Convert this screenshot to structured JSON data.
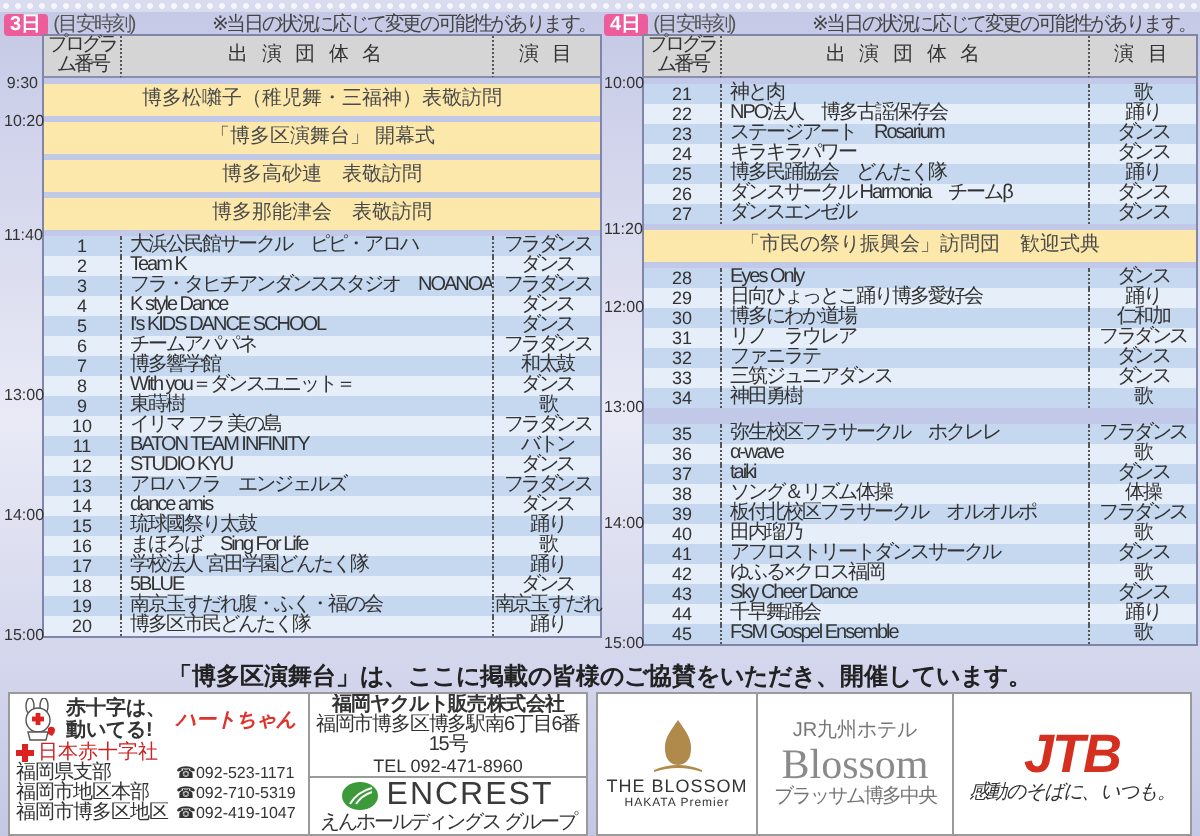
{
  "days": [
    {
      "label": "3日",
      "time_caption": "(目安時刻)",
      "note": "※当日の状況に応じて変更の可能性があります。",
      "columns": [
        "プログラム番号",
        "出 演 団 体 名",
        "演 目"
      ],
      "end_time": "15:00",
      "rows": [
        {
          "kind": "event",
          "time": "9:30",
          "title": "博多松囃子（稚児舞・三福神）表敬訪問"
        },
        {
          "kind": "event",
          "time": "10:20",
          "title": "「博多区演舞台」 開幕式"
        },
        {
          "kind": "event",
          "title": "博多高砂連　表敬訪問"
        },
        {
          "kind": "event",
          "title": "博多那能津会　表敬訪問"
        },
        {
          "kind": "program",
          "time": "11:40",
          "no": "1",
          "name": "大浜公民館サークル　ピピ・アロハ",
          "genre": "フラダンス"
        },
        {
          "kind": "program",
          "no": "2",
          "name": "Team K",
          "genre": "ダンス"
        },
        {
          "kind": "program",
          "no": "3",
          "name": "フラ・タヒチアンダンススタジオ　NOANOA",
          "genre": "フラダンス"
        },
        {
          "kind": "program",
          "no": "4",
          "name": "K style Dance",
          "genre": "ダンス"
        },
        {
          "kind": "program",
          "no": "5",
          "name": "I's KIDS DANCE SCHOOL",
          "genre": "ダンス"
        },
        {
          "kind": "program",
          "no": "6",
          "name": "チームアパパネ",
          "genre": "フラダンス"
        },
        {
          "kind": "program",
          "no": "7",
          "name": "博多響学館",
          "genre": "和太鼓"
        },
        {
          "kind": "program",
          "no": "8",
          "name": "With you＝ダンスユニット＝",
          "genre": "ダンス"
        },
        {
          "kind": "program",
          "time": "13:00",
          "no": "9",
          "name": "東蒔樹",
          "genre": "歌"
        },
        {
          "kind": "program",
          "no": "10",
          "name": "イリマ フラ 美の島",
          "genre": "フラダンス"
        },
        {
          "kind": "program",
          "no": "11",
          "name": "BATON TEAM INFINITY",
          "genre": "バトン"
        },
        {
          "kind": "program",
          "no": "12",
          "name": "STUDIO KYU",
          "genre": "ダンス"
        },
        {
          "kind": "program",
          "no": "13",
          "name": "アロハフラ　エンジェルズ",
          "genre": "フラダンス"
        },
        {
          "kind": "program",
          "no": "14",
          "name": "dance amis",
          "genre": "ダンス"
        },
        {
          "kind": "program",
          "time": "14:00",
          "no": "15",
          "name": "琉球國祭り太鼓",
          "genre": "踊り"
        },
        {
          "kind": "program",
          "no": "16",
          "name": "まほろば　Sing For Life",
          "genre": "歌"
        },
        {
          "kind": "program",
          "no": "17",
          "name": "学校法人 宮田学園どんたく隊",
          "genre": "踊り"
        },
        {
          "kind": "program",
          "no": "18",
          "name": "5BLUE",
          "genre": "ダンス"
        },
        {
          "kind": "program",
          "no": "19",
          "name": "南京玉すだれ腹・ふく・福の会",
          "genre": "南京玉すだれ"
        },
        {
          "kind": "program",
          "no": "20",
          "name": "博多区市民どんたく隊",
          "genre": "踊り"
        }
      ]
    },
    {
      "label": "4日",
      "time_caption": "(目安時刻)",
      "note": "※当日の状況に応じて変更の可能性があります。",
      "columns": [
        "プログラム番号",
        "出 演 団 体 名",
        "演 目"
      ],
      "end_time": "15:00",
      "rows": [
        {
          "kind": "program",
          "time": "10:00",
          "no": "21",
          "name": "神と肉",
          "genre": "歌"
        },
        {
          "kind": "program",
          "no": "22",
          "name": "NPO法人　博多古謡保存会",
          "genre": "踊り"
        },
        {
          "kind": "program",
          "no": "23",
          "name": "ステージアート　Rosarium",
          "genre": "ダンス"
        },
        {
          "kind": "program",
          "no": "24",
          "name": "キラキラパワー",
          "genre": "ダンス"
        },
        {
          "kind": "program",
          "no": "25",
          "name": "博多民踊協会　どんたく隊",
          "genre": "踊り"
        },
        {
          "kind": "program",
          "no": "26",
          "name": "ダンスサークル Harmonia　チームβ",
          "genre": "ダンス"
        },
        {
          "kind": "program",
          "no": "27",
          "name": "ダンスエンゼル",
          "genre": "ダンス"
        },
        {
          "kind": "event",
          "time": "11:20",
          "title": "「市民の祭り振興会」訪問団　歓迎式典"
        },
        {
          "kind": "program",
          "no": "28",
          "name": "Eyes Only",
          "genre": "ダンス"
        },
        {
          "kind": "program",
          "no": "29",
          "name": "日向ひょっとこ踊り博多愛好会",
          "genre": "踊り"
        },
        {
          "kind": "program",
          "time": "12:00",
          "no": "30",
          "name": "博多にわか道場",
          "genre": "仁和加"
        },
        {
          "kind": "program",
          "no": "31",
          "name": "リノ　ラウレア",
          "genre": "フラダンス"
        },
        {
          "kind": "program",
          "no": "32",
          "name": "ファニラテ",
          "genre": "ダンス"
        },
        {
          "kind": "program",
          "no": "33",
          "name": "三筑ジュニアダンス",
          "genre": "ダンス"
        },
        {
          "kind": "program",
          "no": "34",
          "name": "神田勇樹",
          "genre": "歌"
        },
        {
          "kind": "gap",
          "time": "13:00"
        },
        {
          "kind": "program",
          "no": "35",
          "name": "弥生校区フラサークル　ホクレレ",
          "genre": "フラダンス"
        },
        {
          "kind": "program",
          "no": "36",
          "name": "α-wave",
          "genre": "歌"
        },
        {
          "kind": "program",
          "no": "37",
          "name": "taiki",
          "genre": "ダンス"
        },
        {
          "kind": "program",
          "no": "38",
          "name": "ソング＆リズム体操",
          "genre": "体操"
        },
        {
          "kind": "program",
          "no": "39",
          "name": "板付北校区フラサークル　オルオルポ",
          "genre": "フラダンス"
        },
        {
          "kind": "program",
          "time": "14:00",
          "no": "40",
          "name": "田内瑠乃",
          "genre": "歌"
        },
        {
          "kind": "program",
          "no": "41",
          "name": "アフロストリートダンスサークル",
          "genre": "ダンス"
        },
        {
          "kind": "program",
          "no": "42",
          "name": "ゆふる×クロス福岡",
          "genre": "歌"
        },
        {
          "kind": "program",
          "no": "43",
          "name": "Sky Cheer Dance",
          "genre": "ダンス"
        },
        {
          "kind": "program",
          "no": "44",
          "name": "千早舞踊会",
          "genre": "踊り"
        },
        {
          "kind": "program",
          "no": "45",
          "name": "FSM Gospel Ensemble",
          "genre": "歌"
        }
      ]
    }
  ],
  "sponsors": {
    "message": "「博多区演舞台」は、ここに掲載の皆様のご協賛をいただき、開催しています。",
    "boxes": [
      [
        {
          "kind": "redcross",
          "slogan": "赤十字は、動いてる!",
          "mascot": "ハートちゃん",
          "org": "日本赤十字社",
          "contacts": [
            {
              "office": "福岡県支部",
              "phone": "☎092-523-1171"
            },
            {
              "office": "福岡市地区本部",
              "phone": "☎092-710-5319"
            },
            {
              "office": "福岡市博多区地区",
              "phone": "☎092-419-1047"
            }
          ]
        },
        {
          "kind": "company",
          "name": "福岡ヤクルト販売株式会社",
          "address": "福岡市博多区博多駅南6丁目6番15号",
          "tel": "TEL 092-471-8960"
        },
        {
          "kind": "encrest",
          "name": "ENCREST",
          "tagline": "えんホールディングス グループ"
        }
      ],
      [
        {
          "kind": "premier",
          "name": "THE BLOSSOM",
          "sub": "HAKATA Premier"
        },
        {
          "kind": "blossom",
          "brand": "JR九州ホテル",
          "name": "Blossom",
          "sub": "ブラッサム博多中央"
        },
        {
          "kind": "jtb",
          "name": "JTB",
          "tagline": "感動のそばに、いつも。"
        }
      ]
    ]
  }
}
